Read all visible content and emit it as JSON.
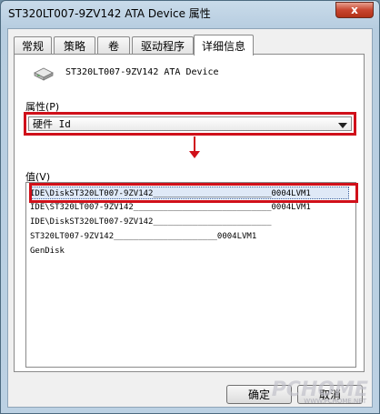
{
  "window": {
    "title": "ST320LT007-9ZV142 ATA Device 属性",
    "close_glyph": "x"
  },
  "tabs": [
    {
      "label": "常规"
    },
    {
      "label": "策略"
    },
    {
      "label": "卷"
    },
    {
      "label": "驱动程序"
    },
    {
      "label": "详细信息"
    }
  ],
  "details": {
    "device_name": "ST320LT007-9ZV142 ATA Device",
    "property_label": "属性(P)",
    "selected_property": "硬件 Id",
    "value_label": "值(V)",
    "values": [
      "IDE\\DiskST320LT007-9ZV142________________________0004LVM1",
      "IDE\\ST320LT007-9ZV142____________________________0004LVM1",
      "IDE\\DiskST320LT007-9ZV142________________________",
      "ST320LT007-9ZV142_____________________0004LVM1",
      "GenDisk"
    ]
  },
  "buttons": {
    "ok": "确定",
    "cancel": "取消"
  },
  "watermark": {
    "main": "PCHOME",
    "sub": "WWW.PCHOME.NET"
  },
  "colors": {
    "highlight_red": "#d0101a",
    "selection": "#dfe9f7"
  }
}
